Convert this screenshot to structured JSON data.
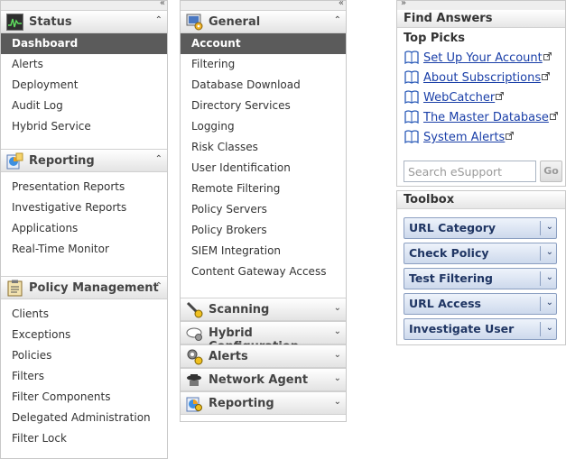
{
  "left_panel": {
    "sections": [
      {
        "title": "Status",
        "icon": "status-monitor-icon",
        "chevron": "⌃",
        "items": [
          "Dashboard",
          "Alerts",
          "Deployment",
          "Audit Log",
          "Hybrid Service"
        ]
      },
      {
        "title": "Reporting",
        "icon": "reporting-chart-icon",
        "chevron": "⌃",
        "items": [
          "Presentation Reports",
          "Investigative Reports",
          "Applications",
          "Real-Time Monitor"
        ]
      },
      {
        "title": "Policy Management",
        "icon": "policy-clipboard-icon",
        "chevron": "⌃",
        "items": [
          "Clients",
          "Exceptions",
          "Policies",
          "Filters",
          "Filter Components",
          "Delegated Administration",
          "Filter Lock"
        ]
      }
    ],
    "active_item": "Dashboard"
  },
  "middle_panel": {
    "general": {
      "title": "General",
      "chevron": "⌃",
      "items": [
        "Account",
        "Filtering",
        "Database Download",
        "Directory Services",
        "Logging",
        "Risk Classes",
        "User Identification",
        "Remote Filtering",
        "Policy Servers",
        "Policy Brokers",
        "SIEM Integration",
        "Content Gateway Access"
      ]
    },
    "active_item": "Account",
    "collapsed": [
      {
        "title": "Scanning",
        "icon": "scanning-icon",
        "chevron": "⌄"
      },
      {
        "title": "Hybrid Configuration",
        "icon": "hybrid-cloud-icon",
        "chevron": "⌄"
      },
      {
        "title": "Alerts",
        "icon": "alerts-gear-icon",
        "chevron": "⌄"
      },
      {
        "title": "Network Agent",
        "icon": "network-agent-icon",
        "chevron": "⌄"
      },
      {
        "title": "Reporting",
        "icon": "reporting-chart-icon",
        "chevron": "⌄"
      }
    ]
  },
  "collapse_glyphs": {
    "left": "«",
    "right": "»"
  },
  "find_answers": {
    "title": "Find Answers",
    "top_picks_label": "Top Picks",
    "links": [
      "Set Up Your Account",
      "About Subscriptions",
      "WebCatcher",
      "The Master Database",
      "System Alerts"
    ],
    "search_placeholder": "Search eSupport",
    "go_label": "Go"
  },
  "toolbox": {
    "title": "Toolbox",
    "tools": [
      "URL Category",
      "Check Policy",
      "Test Filtering",
      "URL Access",
      "Investigate User"
    ],
    "chevron": "⌄"
  },
  "colors": {
    "active_bg": "#5b5b5b",
    "link": "#1a3fa8",
    "tool_text": "#1f3563",
    "tool_border": "#8b9fc1"
  }
}
